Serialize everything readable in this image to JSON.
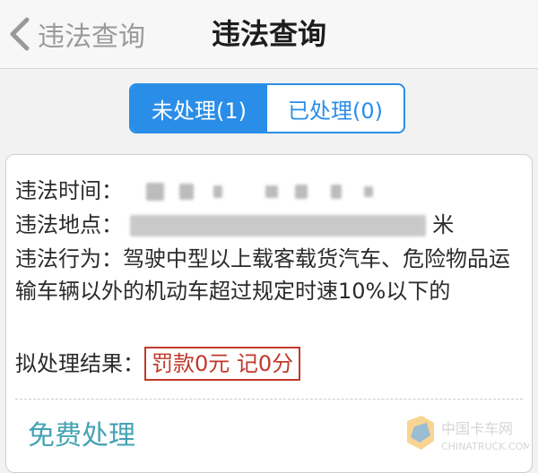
{
  "nav": {
    "back_label": "违法查询",
    "title": "违法查询"
  },
  "tabs": [
    {
      "label": "未处理(1)",
      "active": true
    },
    {
      "label": "已处理(0)",
      "active": false
    }
  ],
  "record": {
    "time_label": "违法时间：",
    "location_label": "违法地点：",
    "location_tail": "米",
    "behavior_label": "违法行为：",
    "behavior_text": "驾驶中型以上载客载货汽车、危险物品运输车辆以外的机动车超过规定时速10%以下的",
    "result_label": "拟处理结果：",
    "result_value": "罚款0元 记0分"
  },
  "action_label": "免费处理",
  "watermark": {
    "cn": "中国卡车网",
    "en": "CHINATRUCK.COM"
  },
  "colors": {
    "accent": "#2a8ee8",
    "result_red": "#c0392b",
    "action_teal": "#43a3b4"
  }
}
